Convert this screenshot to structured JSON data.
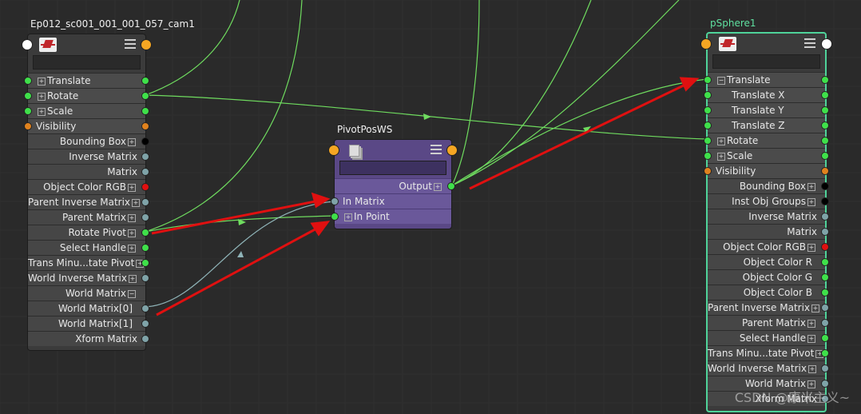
{
  "nodes": {
    "cam": {
      "title": "Ep012_sc001_001_001_057_cam1",
      "attributes": [
        {
          "label": "Translate",
          "side": "in",
          "expand": true
        },
        {
          "label": "Rotate",
          "side": "in",
          "expand": true
        },
        {
          "label": "Scale",
          "side": "in",
          "expand": true
        },
        {
          "label": "Visibility",
          "side": "in"
        },
        {
          "label": "Bounding Box",
          "side": "out",
          "expand": true
        },
        {
          "label": "Inverse Matrix",
          "side": "out"
        },
        {
          "label": "Matrix",
          "side": "out"
        },
        {
          "label": "Object Color RGB",
          "side": "out",
          "expand": true
        },
        {
          "label": "Parent Inverse Matrix",
          "side": "out",
          "expand": true
        },
        {
          "label": "Parent Matrix",
          "side": "out",
          "expand": true
        },
        {
          "label": "Rotate Pivot",
          "side": "out",
          "expand": true
        },
        {
          "label": "Select Handle",
          "side": "out",
          "expand": true
        },
        {
          "label": "Trans Minu...tate Pivot",
          "side": "out",
          "expand": true
        },
        {
          "label": "World Inverse Matrix",
          "side": "out",
          "expand": true
        },
        {
          "label": "World Matrix",
          "side": "out",
          "collapse": true
        },
        {
          "label": "World Matrix[0]",
          "side": "out",
          "child": true
        },
        {
          "label": "World Matrix[1]",
          "side": "out",
          "child": true
        },
        {
          "label": "Xform Matrix",
          "side": "out"
        }
      ]
    },
    "pivot": {
      "title": "PivotPosWS",
      "attributes": [
        {
          "label": "Output",
          "side": "out",
          "expand": true
        },
        {
          "label": "In Matrix",
          "side": "in"
        },
        {
          "label": "In Point",
          "side": "in",
          "expand": true
        }
      ]
    },
    "sphere": {
      "title": "pSphere1",
      "attributes": [
        {
          "label": "Translate",
          "side": "in",
          "collapse": true
        },
        {
          "label": "Translate X",
          "side": "in",
          "child": true
        },
        {
          "label": "Translate Y",
          "side": "in",
          "child": true
        },
        {
          "label": "Translate Z",
          "side": "in",
          "child": true
        },
        {
          "label": "Rotate",
          "side": "in",
          "expand": true
        },
        {
          "label": "Scale",
          "side": "in",
          "expand": true
        },
        {
          "label": "Visibility",
          "side": "in"
        },
        {
          "label": "Bounding Box",
          "side": "out",
          "expand": true
        },
        {
          "label": "Inst Obj Groups",
          "side": "out",
          "expand": true
        },
        {
          "label": "Inverse Matrix",
          "side": "out"
        },
        {
          "label": "Matrix",
          "side": "out"
        },
        {
          "label": "Object Color RGB",
          "side": "out",
          "expand": true
        },
        {
          "label": "Object Color R",
          "side": "out",
          "child": true
        },
        {
          "label": "Object Color G",
          "side": "out",
          "child": true
        },
        {
          "label": "Object Color B",
          "side": "out",
          "child": true
        },
        {
          "label": "Parent Inverse Matrix",
          "side": "out",
          "expand": true
        },
        {
          "label": "Parent Matrix",
          "side": "out",
          "expand": true
        },
        {
          "label": "Select Handle",
          "side": "out",
          "expand": true
        },
        {
          "label": "Trans Minu...tate Pivot",
          "side": "out",
          "expand": true
        },
        {
          "label": "World Inverse Matrix",
          "side": "out",
          "expand": true
        },
        {
          "label": "World Matrix",
          "side": "out",
          "expand": true
        },
        {
          "label": "Xform Matrix",
          "side": "out"
        }
      ]
    }
  },
  "watermark": "CSDN @康米主义~",
  "colors": {
    "background": "#2a2a2a",
    "node_body": "#3b3b3b",
    "pivot_node": "#5a4886",
    "selected_border": "#4fd39a",
    "connection_wire": "#6fdc5f",
    "annotation_arrow": "#e01010"
  }
}
